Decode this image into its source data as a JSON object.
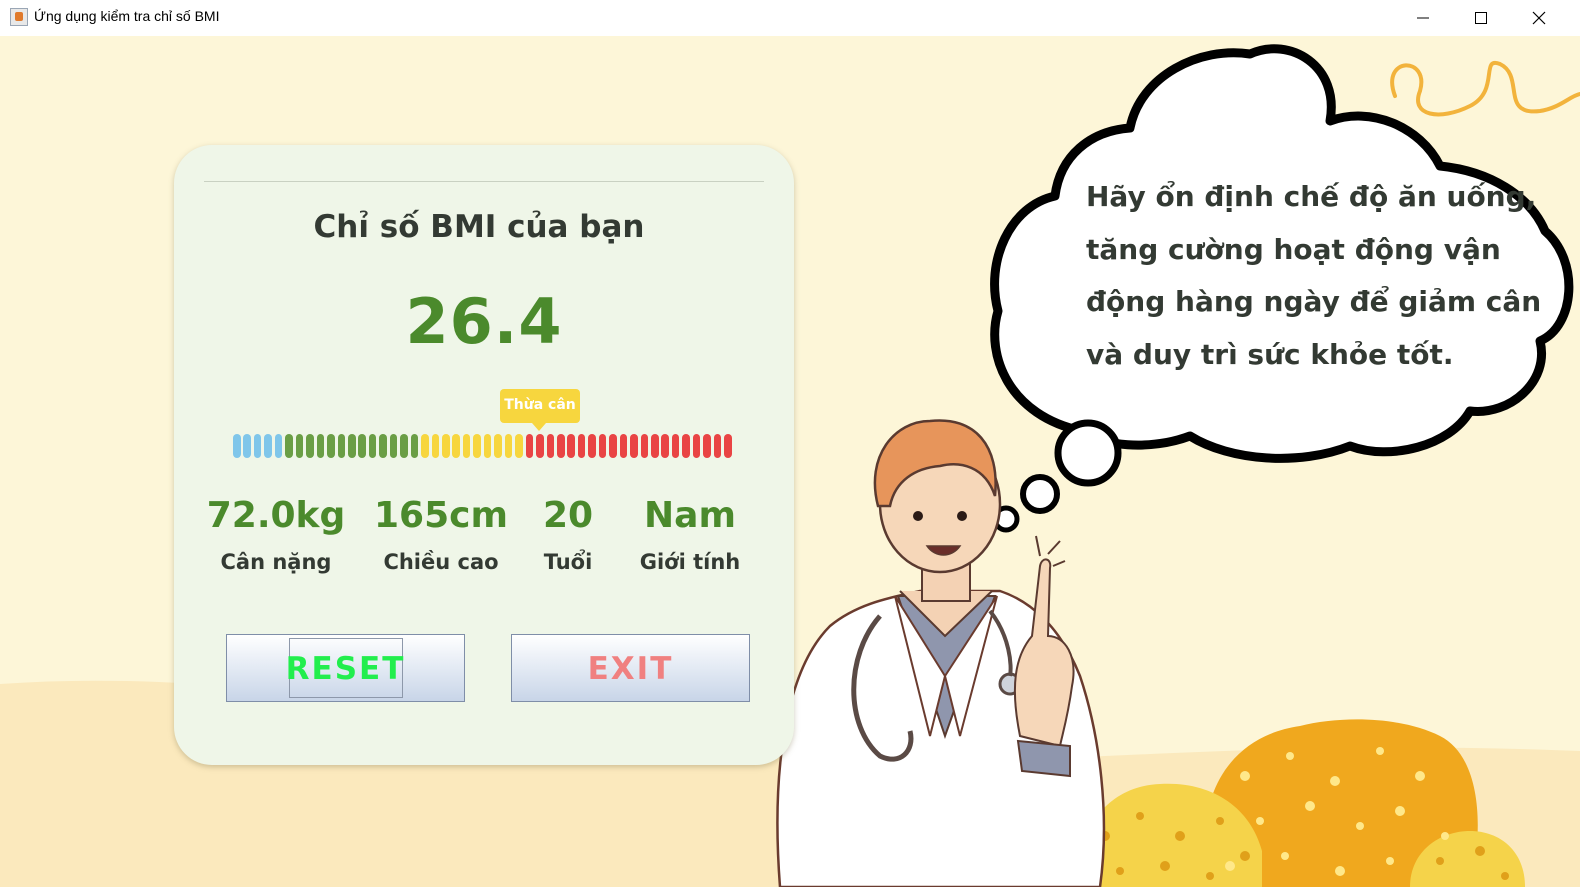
{
  "window": {
    "title": "Ứng dụng kiểm tra chỉ số BMI",
    "controls": [
      "minimize-icon",
      "maximize-icon",
      "close-icon"
    ]
  },
  "result": {
    "title": "Chỉ số BMI của bạn",
    "bmi": "26.4",
    "category": "Thừa cân",
    "scale_min": 16,
    "scale_max": 40,
    "scale_segments": 48,
    "scale_bands": [
      {
        "name": "underweight",
        "color": "#7fc6ea",
        "until": 18.5
      },
      {
        "name": "normal",
        "color": "#6a9e45",
        "until": 25
      },
      {
        "name": "overweight",
        "color": "#f7d63e",
        "until": 30
      },
      {
        "name": "obese",
        "color": "#e94444",
        "until": 40
      }
    ]
  },
  "stats": [
    {
      "value": "72.0kg",
      "label": "Cân nặng"
    },
    {
      "value": "165cm",
      "label": "Chiều cao"
    },
    {
      "value": "20",
      "label": "Tuổi"
    },
    {
      "value": "Nam",
      "label": "Giới tính"
    }
  ],
  "buttons": {
    "reset": "RESET",
    "exit": "EXIT"
  },
  "advice": "Hãy ổn định chế độ ăn uống, tăng cường hoạt động vận động hàng ngày để giảm cân và duy trì sức khỏe tốt.",
  "colors": {
    "background": "#fdf6d8",
    "card": "#eff6e8",
    "accent_green": "#4b8a2c",
    "reset_text": "#22ee4d",
    "exit_text": "#f08080",
    "tooltip": "#f7d63e"
  }
}
